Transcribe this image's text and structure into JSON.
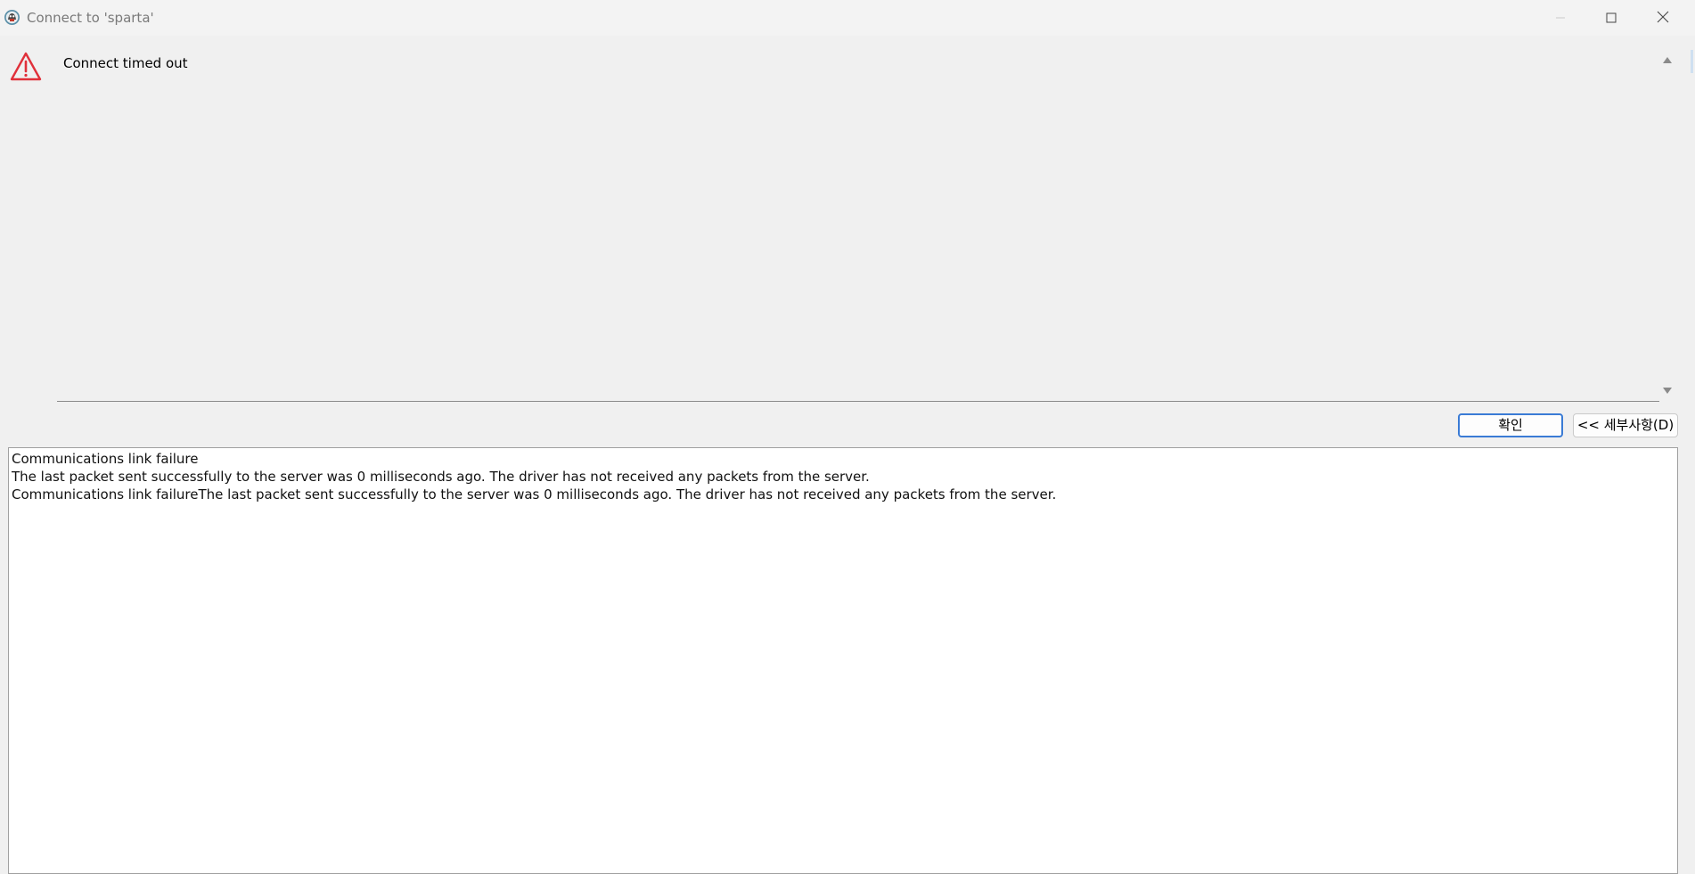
{
  "window": {
    "title": "Connect to 'sparta'"
  },
  "icons": {
    "app": "dbeaver-app-icon",
    "warning": "warning-triangle-icon",
    "minimize": "minimize-icon",
    "maximize": "maximize-icon",
    "close": "close-icon",
    "scroll_up": "scroll-up-arrow-icon",
    "scroll_down": "scroll-down-arrow-icon"
  },
  "message": {
    "text": "Connect timed out"
  },
  "buttons": {
    "ok_label": "확인",
    "details_label": "<< 세부사항(D)"
  },
  "details": {
    "lines": [
      "Communications link failure",
      "The last packet sent successfully to the server was 0 milliseconds ago. The driver has not received any packets from the server.",
      "Communications link failureThe last packet sent successfully to the server was 0 milliseconds ago. The driver has not received any packets from the server."
    ]
  },
  "colors": {
    "warning_red": "#e0303a",
    "focus_blue": "#3a7bd5",
    "background": "#f0f0f0"
  }
}
